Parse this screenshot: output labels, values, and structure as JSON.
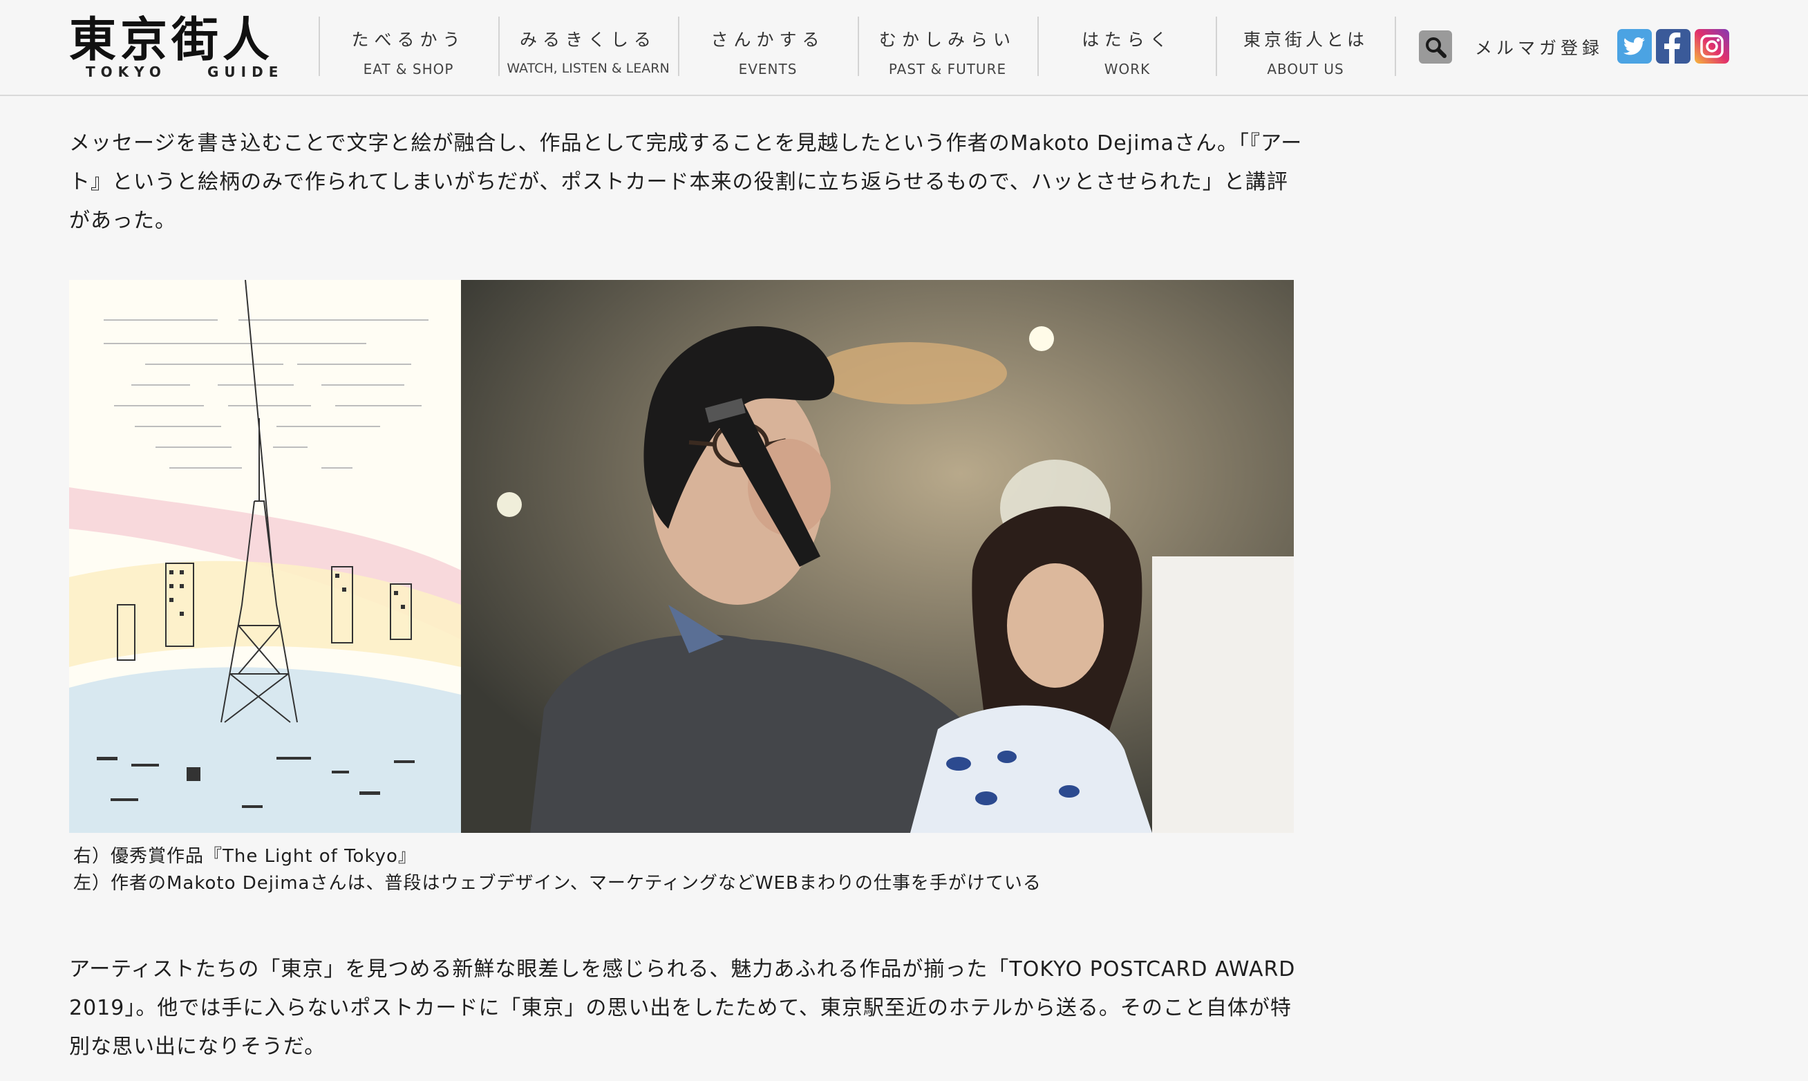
{
  "header": {
    "logo_main": "東京街人",
    "logo_sub_left": "TOKYO",
    "logo_sub_right": "GUIDE",
    "nav": [
      {
        "jp": "たべるかう",
        "en": "EAT & SHOP"
      },
      {
        "jp": "みるきくしる",
        "en": "WATCH, LISTEN & LEARN"
      },
      {
        "jp": "さんかする",
        "en": "EVENTS"
      },
      {
        "jp": "むかしみらい",
        "en": "PAST & FUTURE"
      },
      {
        "jp": "はたらく",
        "en": "WORK"
      },
      {
        "jp": "東京街人とは",
        "en": "ABOUT US"
      }
    ],
    "search_icon": "search-icon",
    "mailmag_label": "メルマガ登録",
    "social": [
      "twitter-icon",
      "facebook-icon",
      "instagram-icon"
    ]
  },
  "article": {
    "paragraph1": "メッセージを書き込むことで文字と絵が融合し、作品として完成することを見越したという作者のMakoto Dejimaさん。「『アート』というと絵柄のみで作られてしまいがちだが、ポストカード本来の役割に立ち返らせるもので、ハッとさせられた」と講評があった。",
    "caption_right": "右）優秀賞作品『The Light of Tokyo』",
    "caption_left": "左）作者のMakoto Dejimaさんは、普段はウェブデザイン、マーケティングなどWEBまわりの仕事を手がけている",
    "paragraph2": "アーティストたちの「東京」を見つめる新鮮な眼差しを感じられる、魅力あふれる作品が揃った「TOKYO POSTCARD AWARD 2019」。他では手に入らないポストカードに「東京」の思い出をしたためて、東京駅至近のホテルから送る。そのこと自体が特別な思い出になりそうだ。"
  },
  "colors": {
    "page_bg": "#f6f6f6",
    "text": "#1f1f1f",
    "twitter": "#4ba3e3",
    "facebook": "#3a5a99"
  }
}
